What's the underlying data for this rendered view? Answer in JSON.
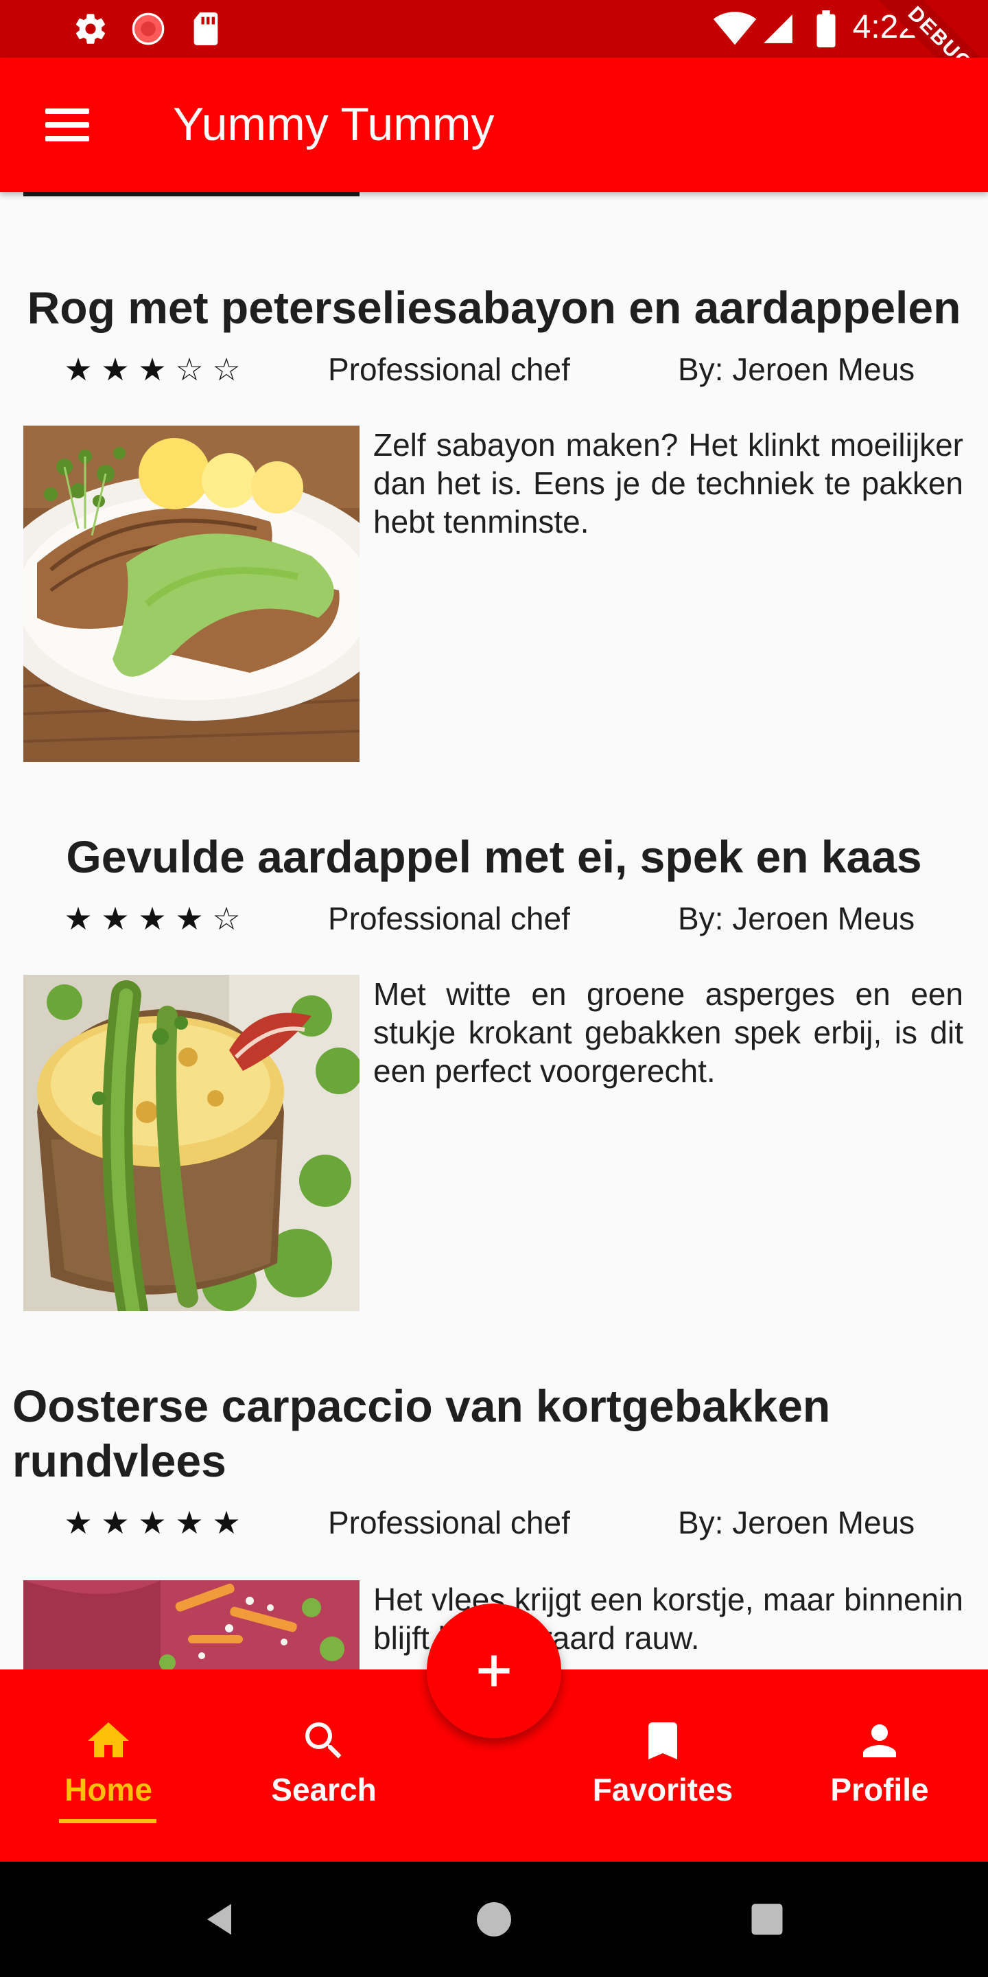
{
  "status_bar": {
    "time": "4:22",
    "icons": [
      "gear-icon",
      "record-icon",
      "sd-card-icon",
      "wifi-icon",
      "signal-icon",
      "battery-icon"
    ],
    "debug_banner": "DEBUG"
  },
  "app_bar": {
    "title": "Yummy Tummy",
    "menu_icon": "hamburger-menu-icon",
    "color": "#ff0000"
  },
  "recipes": [
    {
      "title": "Rog met peterseliesabayon en aardappelen",
      "rating": 3,
      "stars": [
        "★",
        "★",
        "★",
        "☆",
        "☆"
      ],
      "level": "Professional chef",
      "author": "By: Jeroen Meus",
      "description": "Zelf sabayon maken? Het klinkt moeilijker dan het is. Eens je de techniek te pakken hebt tenminste."
    },
    {
      "title": "Gevulde aardappel met ei, spek en kaas",
      "rating": 4,
      "stars": [
        "★",
        "★",
        "★",
        "★",
        "☆"
      ],
      "level": "Professional chef",
      "author": "By: Jeroen Meus",
      "description": "Met witte en groene asperges en een stukje krokant gebakken spek erbij, is dit een perfect voorgerecht."
    },
    {
      "title": "Oosterse carpaccio van kortgebakken rundvlees",
      "rating": 5,
      "stars": [
        "★",
        "★",
        "★",
        "★",
        "★"
      ],
      "level": "Professional chef",
      "author": "By: Jeroen Meus",
      "description": "Het vlees krijgt een korstje, maar binnenin blijft het uiteraard rauw."
    }
  ],
  "fab": {
    "icon": "plus-icon"
  },
  "bottom_nav": {
    "items": [
      {
        "label": "Home",
        "icon": "home-icon",
        "active": true
      },
      {
        "label": "Search",
        "icon": "search-icon",
        "active": false
      },
      {
        "label": "Favorites",
        "icon": "bookmark-icon",
        "active": false
      },
      {
        "label": "Profile",
        "icon": "person-icon",
        "active": false
      }
    ],
    "active_color": "#ffc107"
  },
  "system_nav": {
    "icons": [
      "back-icon",
      "home-circle-icon",
      "recents-icon"
    ]
  }
}
